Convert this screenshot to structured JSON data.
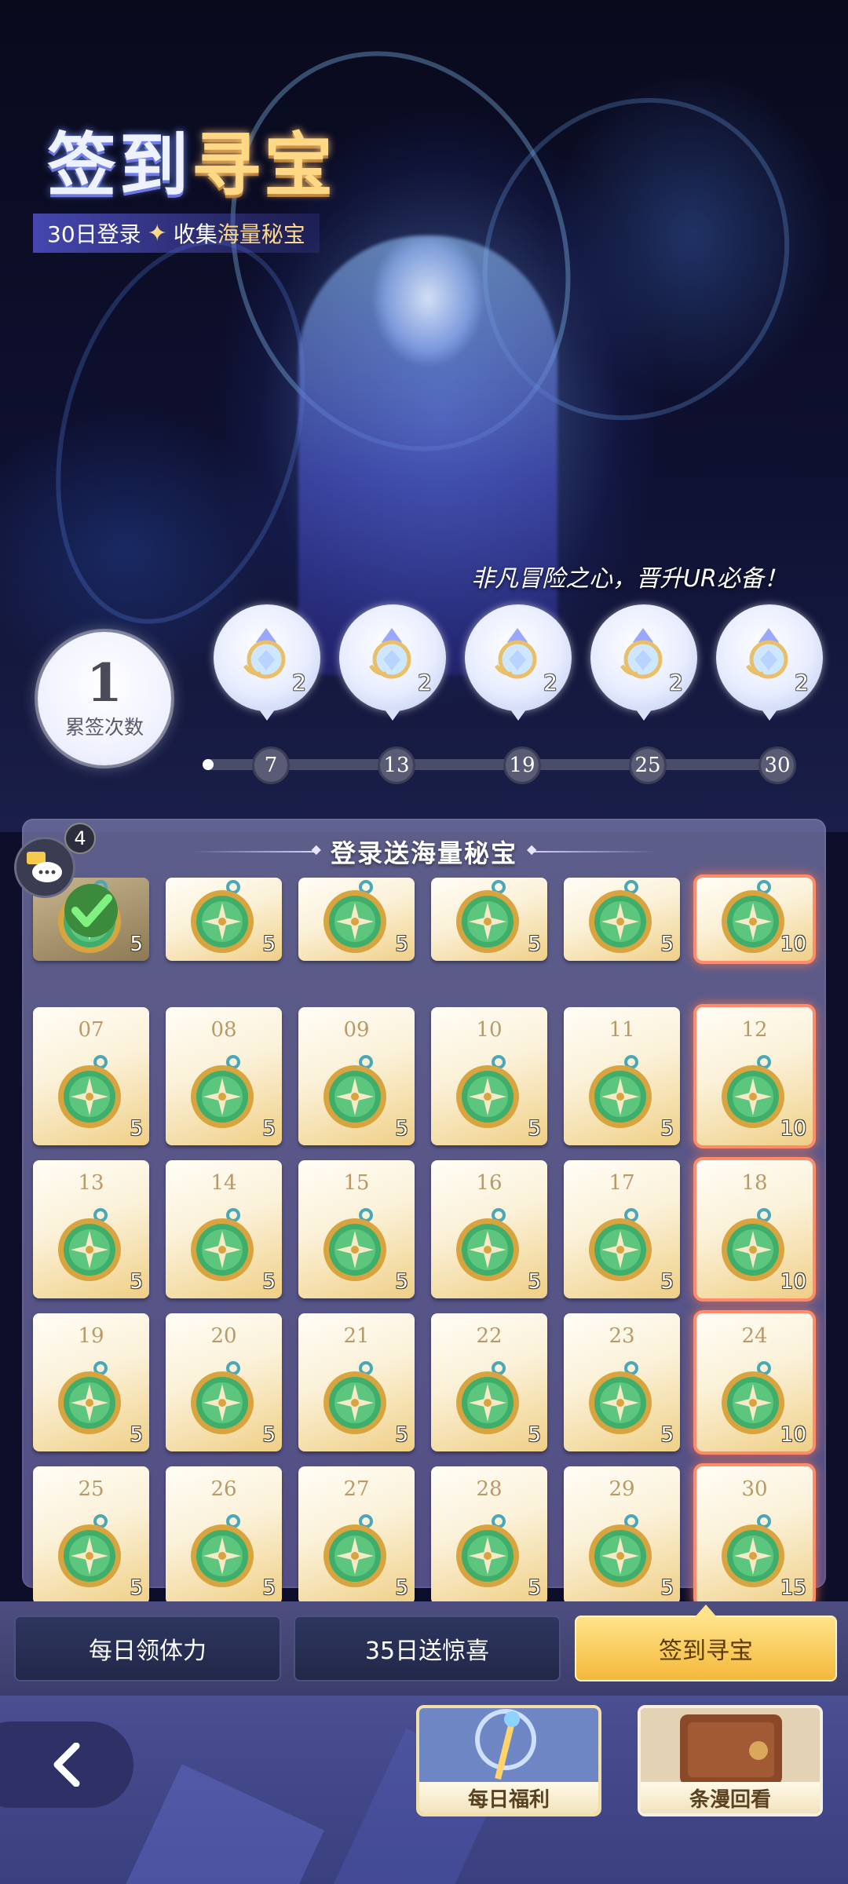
{
  "hero": {
    "title_part1": "签到",
    "title_part2": "寻宝",
    "subtitle_part1": "30日登录",
    "subtitle_part2": "收集",
    "subtitle_part3": "海量秘宝",
    "tagline": "非凡冒险之心，晋升UR必备！"
  },
  "count": {
    "value": "1",
    "label": "累签次数"
  },
  "milestones": [
    {
      "day": "7",
      "qty": "2"
    },
    {
      "day": "13",
      "qty": "2"
    },
    {
      "day": "19",
      "qty": "2"
    },
    {
      "day": "25",
      "qty": "2"
    },
    {
      "day": "30",
      "qty": "2"
    }
  ],
  "progress": {
    "current": 1,
    "max": 30
  },
  "panel": {
    "title": "登录送海量秘宝"
  },
  "chat": {
    "badge": "4"
  },
  "calendar": [
    {
      "day": "",
      "qty": "5",
      "claimed": true
    },
    {
      "day": "",
      "qty": "5"
    },
    {
      "day": "",
      "qty": "5"
    },
    {
      "day": "",
      "qty": "5"
    },
    {
      "day": "",
      "qty": "5"
    },
    {
      "day": "",
      "qty": "10",
      "special": true
    },
    {
      "day": "07",
      "qty": "5"
    },
    {
      "day": "08",
      "qty": "5"
    },
    {
      "day": "09",
      "qty": "5"
    },
    {
      "day": "10",
      "qty": "5"
    },
    {
      "day": "11",
      "qty": "5"
    },
    {
      "day": "12",
      "qty": "10",
      "special": true
    },
    {
      "day": "13",
      "qty": "5"
    },
    {
      "day": "14",
      "qty": "5"
    },
    {
      "day": "15",
      "qty": "5"
    },
    {
      "day": "16",
      "qty": "5"
    },
    {
      "day": "17",
      "qty": "5"
    },
    {
      "day": "18",
      "qty": "10",
      "special": true
    },
    {
      "day": "19",
      "qty": "5"
    },
    {
      "day": "20",
      "qty": "5"
    },
    {
      "day": "21",
      "qty": "5"
    },
    {
      "day": "22",
      "qty": "5"
    },
    {
      "day": "23",
      "qty": "5"
    },
    {
      "day": "24",
      "qty": "10",
      "special": true
    },
    {
      "day": "25",
      "qty": "5"
    },
    {
      "day": "26",
      "qty": "5"
    },
    {
      "day": "27",
      "qty": "5"
    },
    {
      "day": "28",
      "qty": "5"
    },
    {
      "day": "29",
      "qty": "5"
    },
    {
      "day": "30",
      "qty": "15",
      "special": true
    }
  ],
  "tabs": [
    {
      "label": "每日领体力",
      "active": false
    },
    {
      "label": "35日送惊喜",
      "active": false
    },
    {
      "label": "签到寻宝",
      "active": true
    }
  ],
  "features": [
    {
      "label": "每日福利"
    },
    {
      "label": "条漫回看"
    }
  ],
  "colors": {
    "accent_gold": "#ffd886",
    "active_tab": "#f4b83a",
    "special_glow": "#ff8b6b"
  }
}
